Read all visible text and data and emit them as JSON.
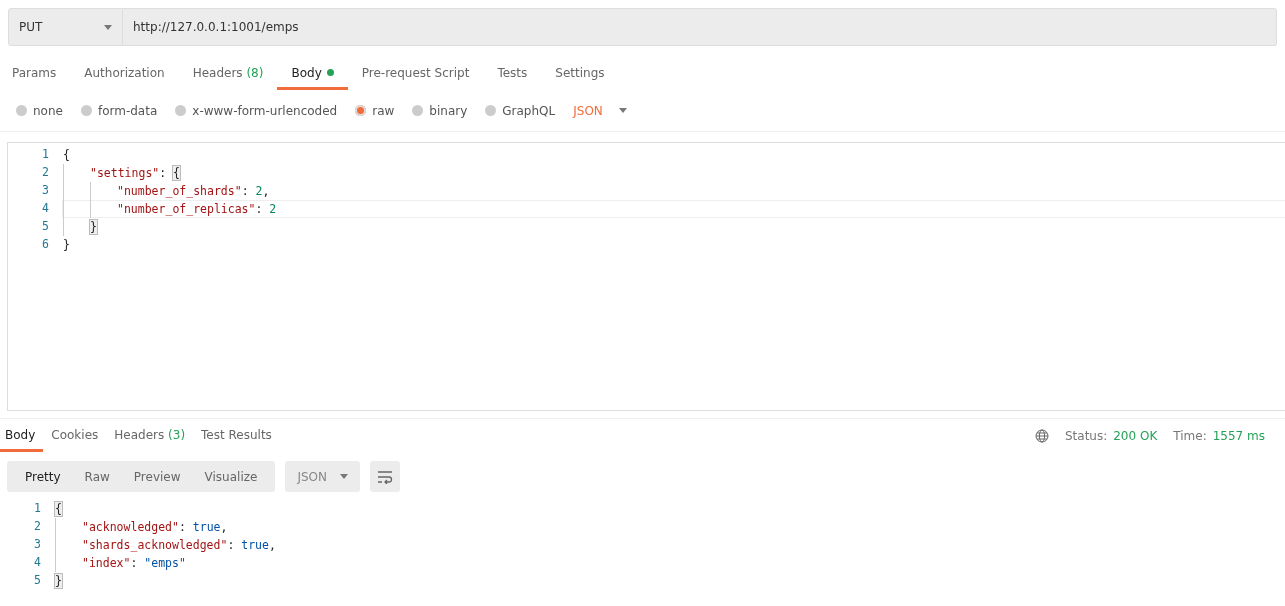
{
  "request": {
    "method": "PUT",
    "url": "http://127.0.0.1:1001/emps"
  },
  "request_tabs": [
    {
      "label": "Params",
      "selected": false
    },
    {
      "label": "Authorization",
      "selected": false
    },
    {
      "label": "Headers",
      "count": "(8)",
      "selected": false
    },
    {
      "label": "Body",
      "dot": true,
      "selected": true
    },
    {
      "label": "Pre-request Script",
      "selected": false
    },
    {
      "label": "Tests",
      "selected": false
    },
    {
      "label": "Settings",
      "selected": false
    }
  ],
  "body_types": [
    {
      "label": "none",
      "selected": false
    },
    {
      "label": "form-data",
      "selected": false
    },
    {
      "label": "x-www-form-urlencoded",
      "selected": false
    },
    {
      "label": "raw",
      "selected": true
    },
    {
      "label": "binary",
      "selected": false
    },
    {
      "label": "GraphQL",
      "selected": false
    }
  ],
  "body_format": "JSON",
  "editor_lines": [
    {
      "number": "1",
      "active": false,
      "tokens": [
        {
          "t": "{",
          "kind": "open",
          "matched": false
        }
      ]
    },
    {
      "number": "2",
      "active": false,
      "tokens": [
        {
          "t": "\"settings\"",
          "kind": "key"
        },
        {
          "t": ": ",
          "kind": "punct"
        },
        {
          "t": "{",
          "kind": "open",
          "matched": true
        }
      ]
    },
    {
      "number": "3",
      "active": false,
      "tokens": [
        {
          "t": "\"number_of_shards\"",
          "kind": "key"
        },
        {
          "t": ": ",
          "kind": "punct"
        },
        {
          "t": "2",
          "kind": "number"
        },
        {
          "t": ",",
          "kind": "punct"
        }
      ]
    },
    {
      "number": "4",
      "active": true,
      "tokens": [
        {
          "t": "\"number_of_replicas\"",
          "kind": "key"
        },
        {
          "t": ": ",
          "kind": "punct"
        },
        {
          "t": "2",
          "kind": "number"
        }
      ]
    },
    {
      "number": "5",
      "active": false,
      "tokens": [
        {
          "t": "}",
          "kind": "close",
          "matched": true
        }
      ]
    },
    {
      "number": "6",
      "active": false,
      "tokens": [
        {
          "t": "}",
          "kind": "close",
          "matched": false
        }
      ]
    }
  ],
  "response_tabs": [
    {
      "label": "Body",
      "selected": true
    },
    {
      "label": "Cookies",
      "selected": false
    },
    {
      "label": "Headers",
      "count": "(3)",
      "selected": false
    },
    {
      "label": "Test Results",
      "selected": false
    }
  ],
  "status": {
    "status_label": "Status:",
    "status_value": "200 OK",
    "time_label": "Time:",
    "time_value": "1557 ms"
  },
  "view_modes": [
    {
      "label": "Pretty",
      "selected": true
    },
    {
      "label": "Raw",
      "selected": false
    },
    {
      "label": "Preview",
      "selected": false
    },
    {
      "label": "Visualize",
      "selected": false
    }
  ],
  "response_format": "JSON",
  "response_lines": [
    {
      "number": "1",
      "active": false,
      "tokens": [
        {
          "t": "{",
          "kind": "open",
          "matched": true
        }
      ]
    },
    {
      "number": "2",
      "active": false,
      "tokens": [
        {
          "t": "\"acknowledged\"",
          "kind": "key"
        },
        {
          "t": ": ",
          "kind": "punct"
        },
        {
          "t": "true",
          "kind": "bool"
        },
        {
          "t": ",",
          "kind": "punct"
        }
      ]
    },
    {
      "number": "3",
      "active": false,
      "tokens": [
        {
          "t": "\"shards_acknowledged\"",
          "kind": "key"
        },
        {
          "t": ": ",
          "kind": "punct"
        },
        {
          "t": "true",
          "kind": "bool"
        },
        {
          "t": ",",
          "kind": "punct"
        }
      ]
    },
    {
      "number": "4",
      "active": false,
      "tokens": [
        {
          "t": "\"index\"",
          "kind": "key"
        },
        {
          "t": ": ",
          "kind": "punct"
        },
        {
          "t": "\"emps\"",
          "kind": "string"
        }
      ]
    },
    {
      "number": "5",
      "active": false,
      "tokens": [
        {
          "t": "}",
          "kind": "close",
          "matched": true
        }
      ]
    }
  ]
}
